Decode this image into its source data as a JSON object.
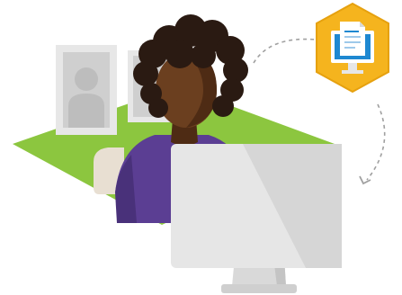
{
  "illustration": {
    "subject": "person-working-at-desktop-computer",
    "icons": [
      "document-on-monitor-icon",
      "portrait-frame-icon",
      "desktop-monitor-icon",
      "dashed-arrow-icon"
    ]
  },
  "colors": {
    "background": "#ffffff",
    "green_floor": "#8cc63f",
    "badge_yellow": "#f5b41e",
    "badge_border": "#e6a10f",
    "skin": "#6b3f1f",
    "skin_shadow": "#4e2b14",
    "hair": "#2a1a12",
    "shirt": "#5b3e93",
    "shirt_shadow": "#49317a",
    "monitor_front": "#e6e6e6",
    "monitor_side": "#cfcfcf",
    "monitor_stand": "#d9d9d9",
    "frame": "#e7e7e7",
    "frame_inner": "#cfcfcf",
    "silhouette": "#bdbdbd",
    "screen_blue": "#1e88d1",
    "dashed_line": "#a0a0a0"
  }
}
